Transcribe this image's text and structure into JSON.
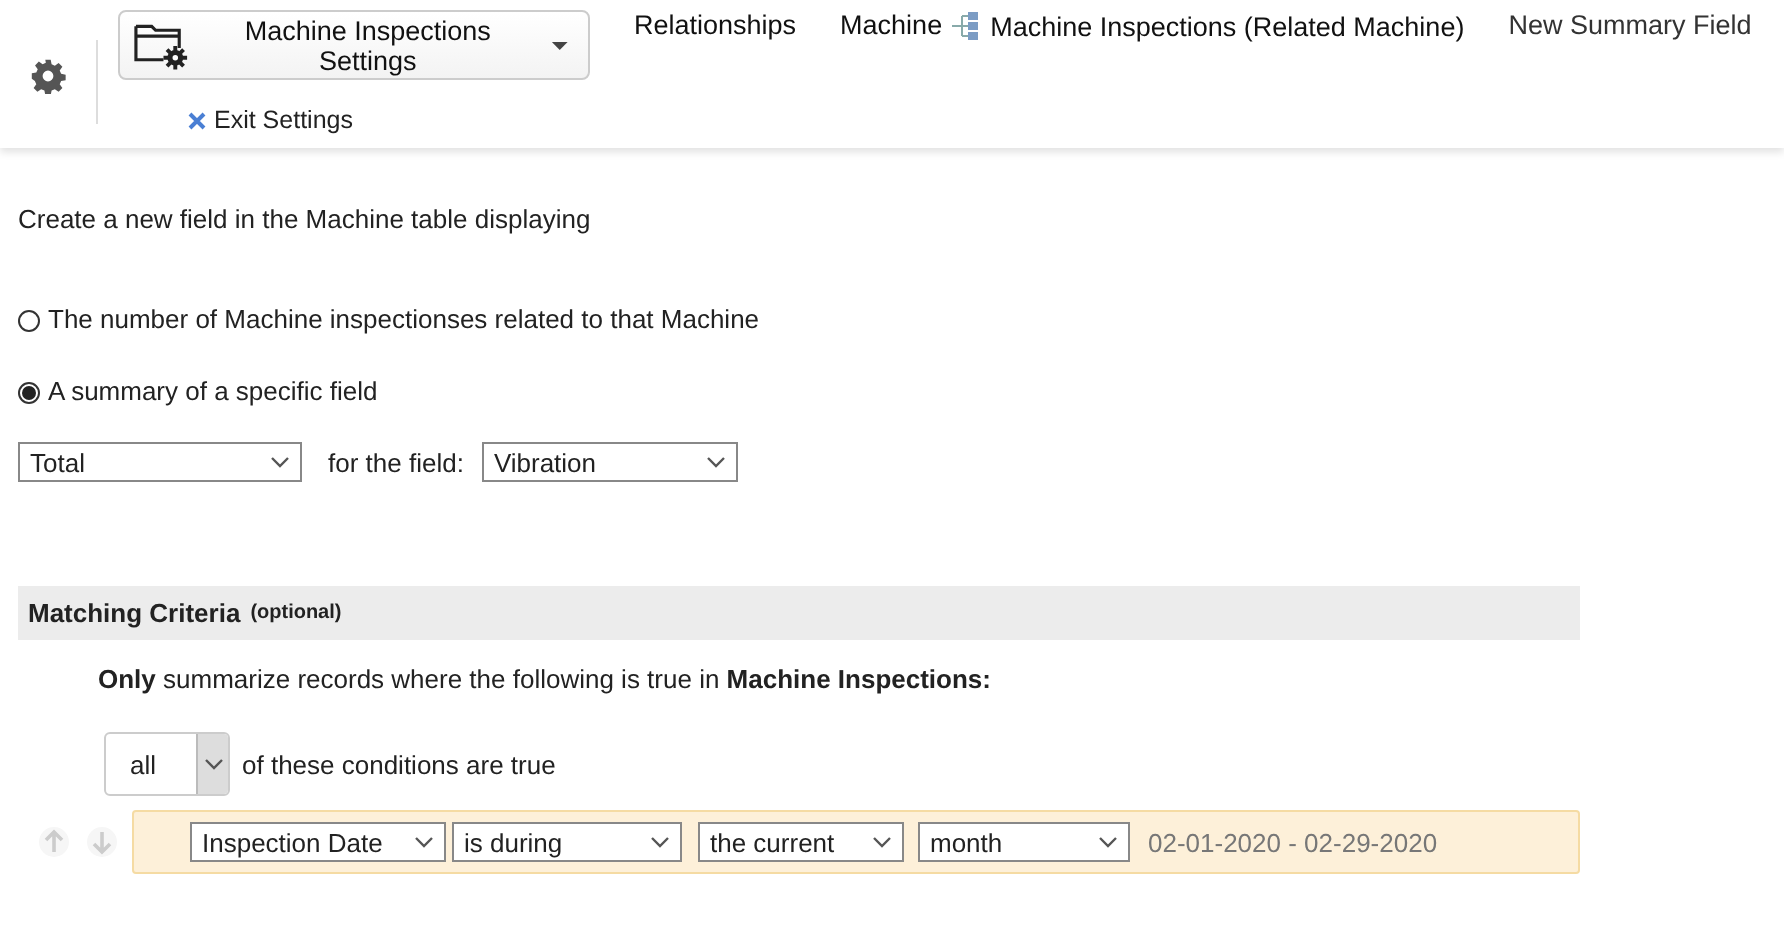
{
  "header": {
    "settings_menu": "Machine Inspections Settings",
    "exit_settings": "Exit Settings",
    "breadcrumbs": [
      {
        "text": "Relationships",
        "kind": "link"
      },
      {
        "text": "Machine",
        "kind": "link"
      },
      {
        "text": "Machine Inspections (Related Machine)",
        "kind": "relation"
      },
      {
        "text": "New Summary Field",
        "kind": "current"
      }
    ]
  },
  "intro": "Create a new field in the Machine table displaying",
  "options": [
    {
      "label": "The number of Machine inspectionses related to that Machine",
      "selected": false
    },
    {
      "label": "A summary of a specific field",
      "selected": true
    }
  ],
  "summary": {
    "function": "Total",
    "for_label": "for the field:",
    "field": "Vibration"
  },
  "criteria": {
    "title": "Matching Criteria",
    "note": "(optional)",
    "description": "**Only** summarize records where the following is true in **Machine Inspections:**",
    "match": "all",
    "match_suffix": "of these conditions are true",
    "conditions": [
      {
        "field": "Inspection Date",
        "operator": "is during",
        "qualifier": "the current",
        "period": "month",
        "range": "02-01-2020 - 02-29-2020"
      }
    ]
  }
}
